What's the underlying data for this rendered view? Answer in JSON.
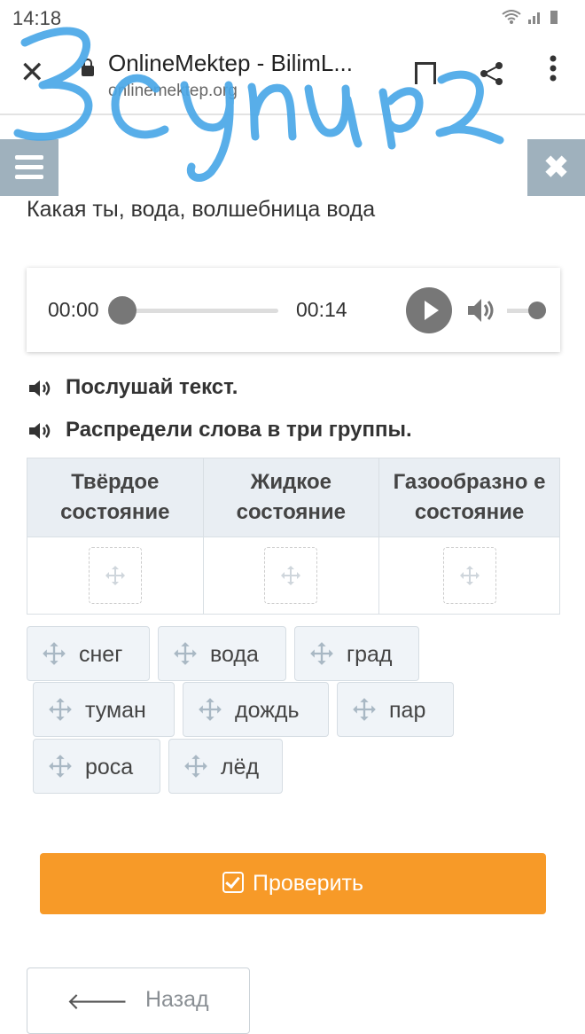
{
  "status_bar": {
    "time": "14:18",
    "icons": "wifi-icon signal-icon battery-icon"
  },
  "browser": {
    "title": "OnlineMektep - BilimL...",
    "url": "onlinemektep.org",
    "close_icon": "close-icon",
    "lock_icon": "lock-icon",
    "bookmark_icon": "bookmark-icon",
    "share_icon": "share-icon",
    "menu_icon": "more-vertical-icon"
  },
  "handwriting": "3 сынып",
  "page": {
    "menu_icon": "hamburger-icon",
    "close_label": "✖",
    "title": "Какая ты, вода, волшебница вода"
  },
  "player": {
    "current_time": "00:00",
    "total_time": "00:14",
    "progress": 0,
    "volume": 1
  },
  "instructions": [
    {
      "icon": "speaker-icon",
      "text": "Послушай текст."
    },
    {
      "icon": "speaker-icon",
      "text": "Распредели слова в три группы."
    }
  ],
  "table": {
    "headers": [
      "Твёрдое состояние",
      "Жидкое состояние",
      "Газообразно е состояние"
    ],
    "dropzone_icon": "drag-move-icon"
  },
  "words": [
    "снег",
    "вода",
    "град",
    "туман",
    "дождь",
    "пар",
    "роса",
    "лёд"
  ],
  "buttons": {
    "check": "Проверить",
    "back": "Назад"
  },
  "colors": {
    "accent": "#f79a28",
    "side_button": "#9fb1bd",
    "table_header": "#e9eef3",
    "handwriting": "#4aa8e8"
  }
}
